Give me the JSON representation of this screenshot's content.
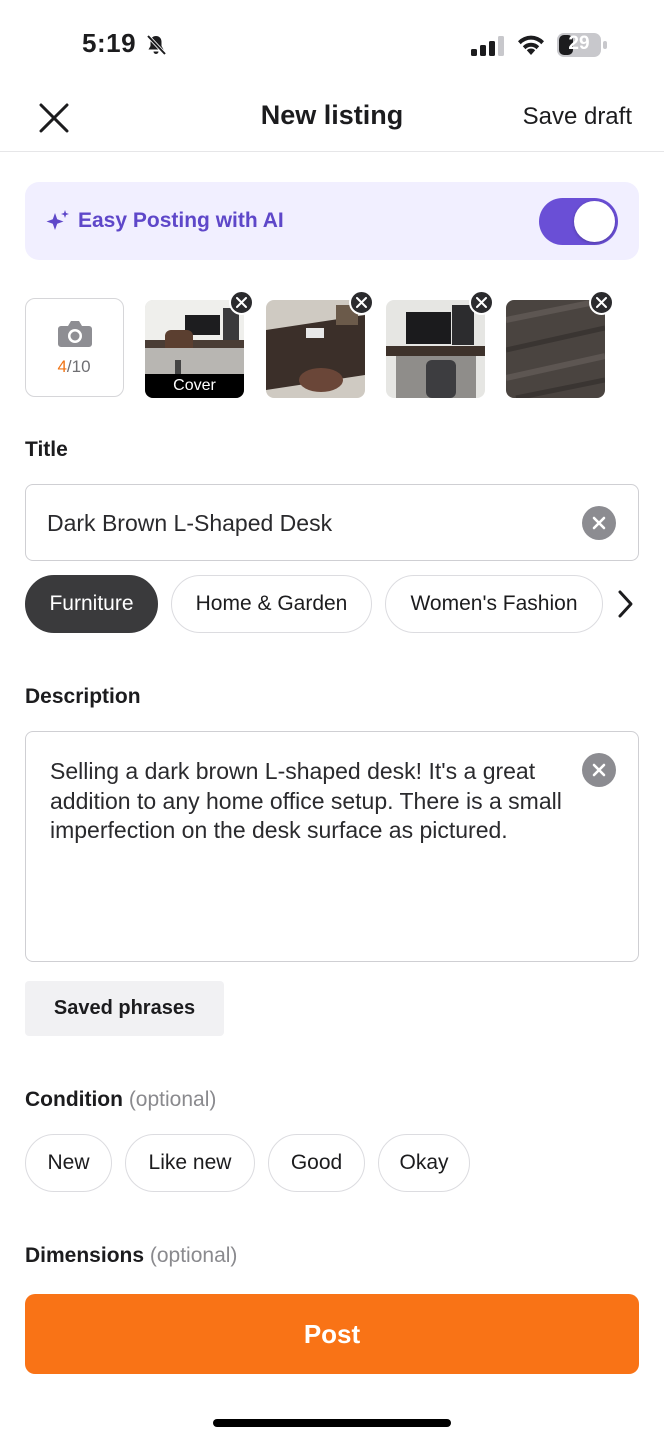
{
  "status_bar": {
    "time": "5:19",
    "battery": "29"
  },
  "nav": {
    "title": "New listing",
    "save_draft": "Save draft"
  },
  "ai_banner": {
    "label": "Easy Posting with AI",
    "toggle_on": true,
    "accent": "#6a4fd6"
  },
  "photos": {
    "count_current": "4",
    "count_total": "/10",
    "cover_label": "Cover"
  },
  "title_section": {
    "label": "Title",
    "value": "Dark Brown L-Shaped Desk"
  },
  "categories": [
    "Furniture",
    "Home & Garden",
    "Women's Fashion"
  ],
  "selected_category": "Furniture",
  "description_section": {
    "label": "Description",
    "value": "Selling a dark brown L-shaped desk! It's a great addition to any home office setup. There is a small imperfection on the desk surface as pictured."
  },
  "saved_phrases": "Saved phrases",
  "condition": {
    "label": "Condition",
    "optional": "(optional)",
    "options": [
      "New",
      "Like new",
      "Good",
      "Okay"
    ]
  },
  "dimensions": {
    "label": "Dimensions",
    "optional": "(optional)"
  },
  "post_button": "Post",
  "colors": {
    "brand_orange": "#f97316",
    "ai_purple": "#5e47c9"
  }
}
